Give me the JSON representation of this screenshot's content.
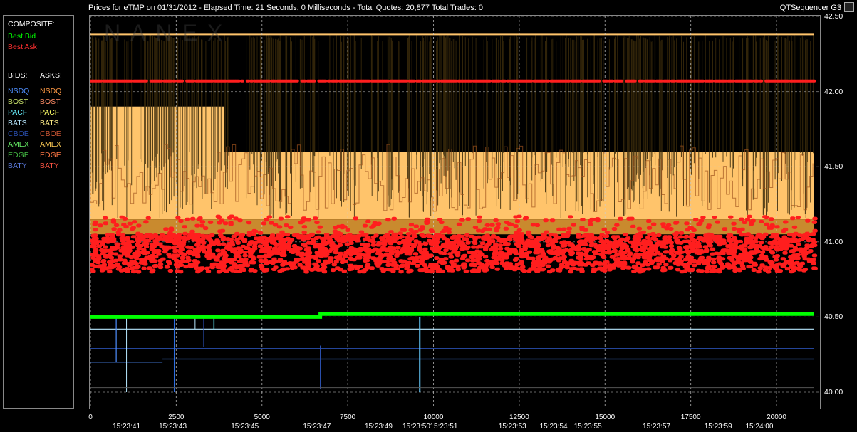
{
  "header": {
    "title": "Prices for  eTMP  on  01/31/2012  -  Elapsed Time: 21 Seconds, 0 Milliseconds  -  Total Quotes: 20,877  Total Trades: 0",
    "app_name": "QTSequencer G3",
    "watermark": "NANEX"
  },
  "legend": {
    "composite_label": "COMPOSITE:",
    "best_bid": {
      "label": "Best Bid",
      "color": "#00ff00"
    },
    "best_ask": {
      "label": "Best Ask",
      "color": "#ff3030"
    },
    "bids_label": "BIDS:",
    "asks_label": "ASKS:",
    "bids": [
      {
        "label": "NSDQ",
        "color": "#4f8fff"
      },
      {
        "label": "BOST",
        "color": "#c8e06a"
      },
      {
        "label": "PACF",
        "color": "#66f0ff"
      },
      {
        "label": "BATS",
        "color": "#b8e8ff"
      },
      {
        "label": "CBOE",
        "color": "#2a4fb0"
      },
      {
        "label": "AMEX",
        "color": "#66ee66"
      },
      {
        "label": "EDGE",
        "color": "#44bb44"
      },
      {
        "label": "BATY",
        "color": "#5c7ce0"
      }
    ],
    "asks": [
      {
        "label": "NSDQ",
        "color": "#ff9944"
      },
      {
        "label": "BOST",
        "color": "#ff8c66"
      },
      {
        "label": "PACF",
        "color": "#ffff66"
      },
      {
        "label": "BATS",
        "color": "#ffee88"
      },
      {
        "label": "CBOE",
        "color": "#cc5533"
      },
      {
        "label": "AMEX",
        "color": "#ffcc55"
      },
      {
        "label": "EDGE",
        "color": "#ff7744"
      },
      {
        "label": "BATY",
        "color": "#ff5544"
      }
    ]
  },
  "chart_data": {
    "type": "line",
    "x_ticks": [
      "0",
      "2500",
      "5000",
      "7500",
      "10000",
      "12500",
      "15000",
      "17500",
      "20000"
    ],
    "x_tick_values": [
      0,
      2500,
      5000,
      7500,
      10000,
      12500,
      15000,
      17500,
      20000
    ],
    "time_ticks": [
      {
        "x": 1050,
        "label": "15:23:41"
      },
      {
        "x": 2400,
        "label": "15:23:43"
      },
      {
        "x": 4500,
        "label": "15:23:45"
      },
      {
        "x": 6600,
        "label": "15:23:47"
      },
      {
        "x": 8400,
        "label": "15:23:49"
      },
      {
        "x": 9500,
        "label": "15:23:50"
      },
      {
        "x": 10300,
        "label": "15:23:51"
      },
      {
        "x": 12300,
        "label": "15:23:53"
      },
      {
        "x": 13500,
        "label": "15:23:54"
      },
      {
        "x": 14500,
        "label": "15:23:55"
      },
      {
        "x": 16500,
        "label": "15:23:57"
      },
      {
        "x": 18300,
        "label": "15:23:59"
      },
      {
        "x": 19500,
        "label": "15:24:00"
      }
    ],
    "y_ticks": [
      "42.50",
      "42.00",
      "41.50",
      "41.00",
      "40.50",
      "40.00"
    ],
    "y_tick_values": [
      42.5,
      42.0,
      41.5,
      41.0,
      40.5,
      40.0
    ],
    "xlim": [
      0,
      21100
    ],
    "ylim": [
      40.0,
      42.5
    ],
    "grid": true,
    "series": [
      {
        "name": "Best Bid",
        "color": "#00ff00",
        "values": [
          [
            0,
            40.5
          ],
          [
            6700,
            40.5
          ],
          [
            6700,
            40.52
          ],
          [
            21100,
            40.52
          ]
        ]
      },
      {
        "name": "Best Ask",
        "color": "#ff2020",
        "band": [
          40.8,
          41.05
        ],
        "outer": [
          [
            0,
            42.07
          ],
          [
            21100,
            42.07
          ]
        ]
      },
      {
        "name": "BATS",
        "color": "#b8e8ff",
        "values": [
          [
            0,
            40.42
          ],
          [
            21100,
            40.42
          ]
        ]
      },
      {
        "name": "CBOE",
        "color": "#2a4fb0",
        "values": [
          [
            0,
            40.3
          ],
          [
            6700,
            40.3
          ],
          [
            21100,
            40.3
          ]
        ]
      },
      {
        "name": "NSDQ",
        "color": "#4f8fff",
        "values": [
          [
            0,
            40.2
          ],
          [
            21100,
            40.22
          ]
        ]
      }
    ],
    "ask_band_levels": [
      {
        "from": 0,
        "to": 3900,
        "top": 41.9
      },
      {
        "from": 3900,
        "to": 21100,
        "top": 41.6
      }
    ]
  }
}
